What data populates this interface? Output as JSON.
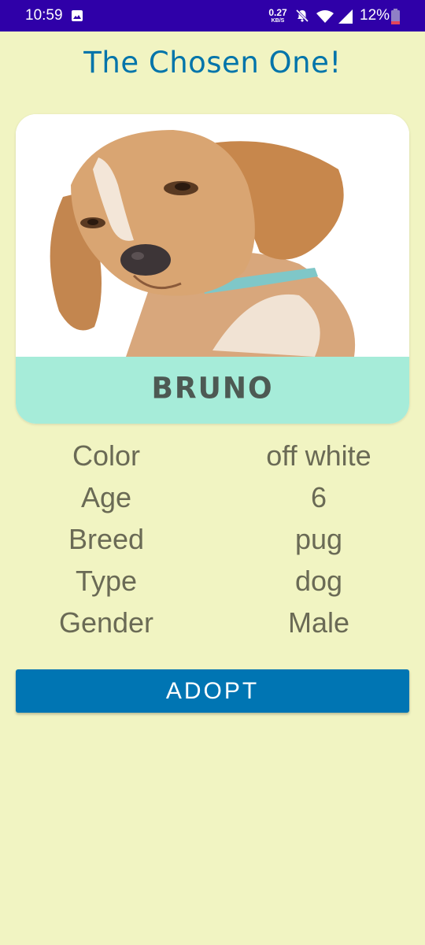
{
  "status_bar": {
    "time": "10:59",
    "net_speed_value": "0.27",
    "net_speed_unit": "KB/S",
    "battery_percent": "12%",
    "icons": [
      "gallery-icon",
      "mute-icon",
      "wifi-icon",
      "signal-icon",
      "battery-icon"
    ],
    "background_color": "#2f00a8"
  },
  "header": {
    "title": "The Chosen One!"
  },
  "pet_card": {
    "name": "BRUNO",
    "name_strip_color": "#a6ecd9"
  },
  "details": [
    {
      "label": "Color",
      "value": "off white"
    },
    {
      "label": "Age",
      "value": "6"
    },
    {
      "label": "Breed",
      "value": "pug"
    },
    {
      "label": "Type",
      "value": "dog"
    },
    {
      "label": "Gender",
      "value": "Male"
    }
  ],
  "actions": {
    "adopt_label": "ADOPT",
    "adopt_color": "#0075b3"
  },
  "theme": {
    "background": "#f1f4c2",
    "title_color": "#0074aa"
  }
}
